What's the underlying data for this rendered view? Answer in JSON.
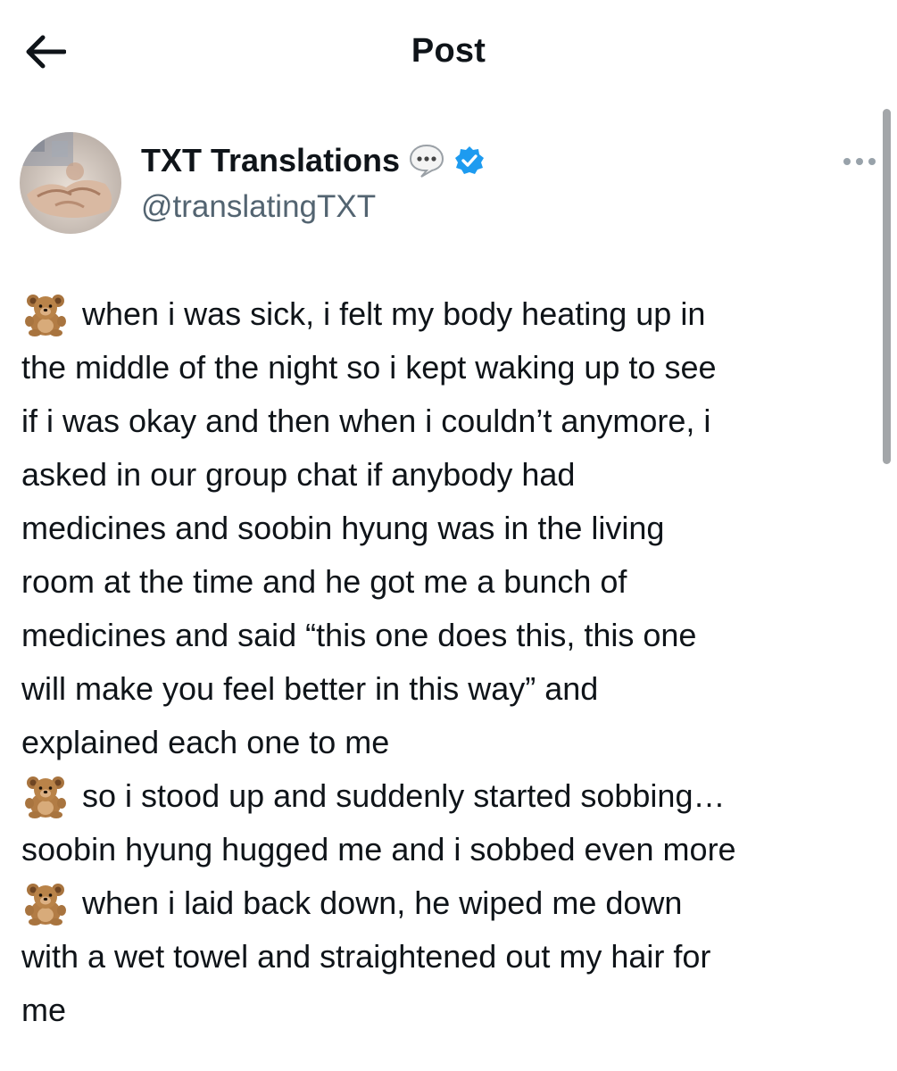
{
  "header": {
    "title": "Post",
    "back_icon": "arrow-left-icon"
  },
  "author": {
    "name": "TXT Translations",
    "handle": "@translatingTXT",
    "badges": [
      "speech-bubble-icon",
      "verified-check-icon"
    ],
    "verified_color": "#1d9bf0"
  },
  "menu": {
    "icon": "more-horizontal-icon"
  },
  "post": {
    "lines": [
      {
        "emoji": "teddy-bear-icon",
        "text": "when i was sick, i felt my body heating up in"
      },
      {
        "emoji": null,
        "text": "the middle of the night so i kept waking up to see"
      },
      {
        "emoji": null,
        "text": "if i was okay and then when i couldn’t anymore, i"
      },
      {
        "emoji": null,
        "text": "asked in our group chat if anybody had"
      },
      {
        "emoji": null,
        "text": "medicines and soobin hyung was in the living"
      },
      {
        "emoji": null,
        "text": "room at the time and he got me a bunch of"
      },
      {
        "emoji": null,
        "text": "medicines and said “this one does this, this one"
      },
      {
        "emoji": null,
        "text": "will make you feel better in this way” and"
      },
      {
        "emoji": null,
        "text": "explained each one to me"
      },
      {
        "emoji": "teddy-bear-icon",
        "text": "so i stood up and suddenly started sobbing…"
      },
      {
        "emoji": null,
        "text": "soobin hyung hugged me and i sobbed even more"
      },
      {
        "emoji": "teddy-bear-icon",
        "text": "when i laid back down, he wiped me down"
      },
      {
        "emoji": null,
        "text": "with a wet towel and straightened out my hair for"
      },
      {
        "emoji": null,
        "text": "me"
      }
    ]
  },
  "colors": {
    "text": "#0f1419",
    "secondary_text": "#536471",
    "accent": "#1d9bf0",
    "scrollbar": "#a3a6a9"
  }
}
